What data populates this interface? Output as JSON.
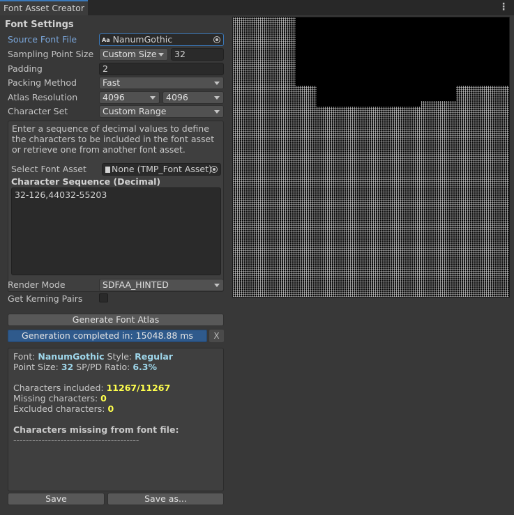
{
  "window": {
    "tab_title": "Font Asset Creator",
    "menu_icon": "kebab-menu-icon"
  },
  "font_settings": {
    "title": "Font Settings",
    "source_font_file": {
      "label": "Source Font File",
      "value": "NanumGothic",
      "icon": "font-asset-icon"
    },
    "sampling_point_size": {
      "label": "Sampling Point Size",
      "mode": "Custom Size",
      "value": "32"
    },
    "padding": {
      "label": "Padding",
      "value": "2"
    },
    "packing_method": {
      "label": "Packing Method",
      "value": "Fast"
    },
    "atlas_resolution": {
      "label": "Atlas Resolution",
      "width": "4096",
      "height": "4096"
    },
    "character_set": {
      "label": "Character Set",
      "value": "Custom Range"
    },
    "help_text": "Enter a sequence of decimal values to define the characters to be included in the font asset or retrieve one from another font asset.",
    "select_font_asset": {
      "label": "Select Font Asset",
      "value": "None (TMP_Font Asset)"
    },
    "character_sequence": {
      "label": "Character Sequence (Decimal)",
      "value": "32-126,44032-55203"
    },
    "render_mode": {
      "label": "Render Mode",
      "value": "SDFAA_HINTED"
    },
    "get_kerning_pairs": {
      "label": "Get Kerning Pairs",
      "checked": false
    }
  },
  "actions": {
    "generate_label": "Generate Font Atlas",
    "progress_text": "Generation completed in: 15048.88 ms",
    "progress_fraction": 1.0,
    "dismiss_label": "X",
    "save_label": "Save",
    "save_as_label": "Save as..."
  },
  "output": {
    "font_prefix": "Font: ",
    "font_name": "NanumGothic",
    "style_prefix": "Style: ",
    "style_value": "Regular",
    "point_size_prefix": "Point Size: ",
    "point_size_value": "32",
    "ratio_prefix": "SP/PD Ratio: ",
    "ratio_value": "6.3%",
    "included_prefix": "Characters included: ",
    "included_value": "11267/11267",
    "missing_prefix": "Missing characters: ",
    "missing_value": "0",
    "excluded_prefix": "Excluded characters: ",
    "excluded_value": "0",
    "missing_header": "Characters missing from font file:",
    "divider": "----------------------------------------"
  },
  "colors": {
    "accent": "#3a79bb",
    "progress": "#2f5a8c",
    "highlight_cyan": "#9ed6ea",
    "highlight_yellow": "#ffff4d"
  }
}
